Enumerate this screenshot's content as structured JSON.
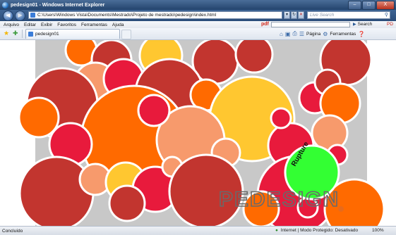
{
  "window": {
    "title": "pedesign01 - Windows Internet Explorer",
    "controls": [
      "–",
      "□",
      "X"
    ]
  },
  "address_bar": {
    "url": "C:\\Users\\Windows Vista\\Documents\\Mestrado\\Projeto de mestrado\\pedesign\\index.html",
    "search_placeholder": "Live Search"
  },
  "menu": {
    "items": [
      "Arquivo",
      "Editar",
      "Exibir",
      "Favoritos",
      "Ferramentas",
      "Ajuda"
    ],
    "pdf_brand": "pdf",
    "search_button": "Search",
    "pdf_tool": "PD"
  },
  "tab_row": {
    "tab_title": "pedesign01",
    "page_menu": "Página",
    "tools_menu": "Ferramentas"
  },
  "content": {
    "background_color": "#c8c8c8",
    "palette": {
      "dark_red": "#c2352f",
      "crimson": "#e81a3c",
      "orange": "#ff6a00",
      "salmon": "#f79a6c",
      "yellow": "#ffc730",
      "green": "#33ff33"
    },
    "rupture_label": "Rupture",
    "logo_text": "PEDESIGN"
  },
  "status_bar": {
    "status": "Concluído",
    "zone": "Internet | Modo Protegido: Desativado",
    "zoom": "100%"
  }
}
